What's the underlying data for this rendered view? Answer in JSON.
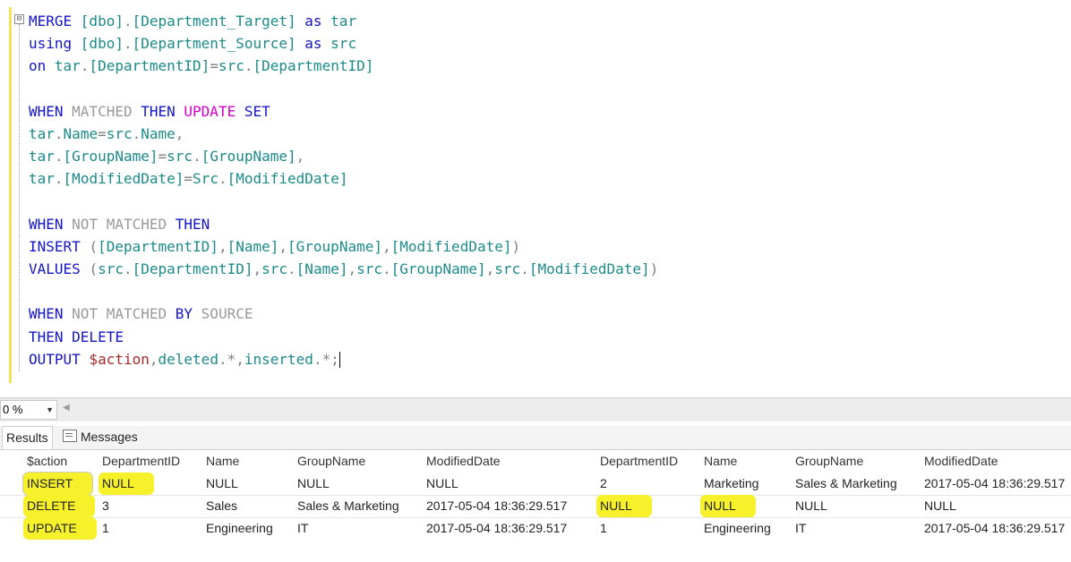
{
  "editor": {
    "collapse_glyph": "⊟",
    "lines": [
      [
        {
          "t": "MERGE ",
          "c": "kw"
        },
        {
          "t": "[dbo]",
          "c": "id"
        },
        {
          "t": ".",
          "c": "pu"
        },
        {
          "t": "[Department_Target]",
          "c": "id"
        },
        {
          "t": " as ",
          "c": "kw"
        },
        {
          "t": "tar",
          "c": "id"
        }
      ],
      [
        {
          "t": "using ",
          "c": "kw"
        },
        {
          "t": "[dbo]",
          "c": "id"
        },
        {
          "t": ".",
          "c": "pu"
        },
        {
          "t": "[Department_Source]",
          "c": "id"
        },
        {
          "t": " as ",
          "c": "kw"
        },
        {
          "t": "src",
          "c": "id"
        }
      ],
      [
        {
          "t": "on ",
          "c": "kw"
        },
        {
          "t": "tar",
          "c": "id"
        },
        {
          "t": ".",
          "c": "pu"
        },
        {
          "t": "[DepartmentID]",
          "c": "id"
        },
        {
          "t": "=",
          "c": "pu"
        },
        {
          "t": "src",
          "c": "id"
        },
        {
          "t": ".",
          "c": "pu"
        },
        {
          "t": "[DepartmentID]",
          "c": "id"
        }
      ],
      [],
      [
        {
          "t": "WHEN ",
          "c": "kw"
        },
        {
          "t": "MATCHED ",
          "c": "gr"
        },
        {
          "t": "THEN ",
          "c": "kw"
        },
        {
          "t": "UPDATE ",
          "c": "mg"
        },
        {
          "t": "SET",
          "c": "kw"
        }
      ],
      [
        {
          "t": "tar",
          "c": "id"
        },
        {
          "t": ".",
          "c": "pu"
        },
        {
          "t": "Name",
          "c": "id"
        },
        {
          "t": "=",
          "c": "pu"
        },
        {
          "t": "src",
          "c": "id"
        },
        {
          "t": ".",
          "c": "pu"
        },
        {
          "t": "Name",
          "c": "id"
        },
        {
          "t": ",",
          "c": "pu"
        }
      ],
      [
        {
          "t": "tar",
          "c": "id"
        },
        {
          "t": ".",
          "c": "pu"
        },
        {
          "t": "[GroupName]",
          "c": "id"
        },
        {
          "t": "=",
          "c": "pu"
        },
        {
          "t": "src",
          "c": "id"
        },
        {
          "t": ".",
          "c": "pu"
        },
        {
          "t": "[GroupName]",
          "c": "id"
        },
        {
          "t": ",",
          "c": "pu"
        }
      ],
      [
        {
          "t": "tar",
          "c": "id"
        },
        {
          "t": ".",
          "c": "pu"
        },
        {
          "t": "[ModifiedDate]",
          "c": "id"
        },
        {
          "t": "=",
          "c": "pu"
        },
        {
          "t": "Src",
          "c": "id"
        },
        {
          "t": ".",
          "c": "pu"
        },
        {
          "t": "[ModifiedDate]",
          "c": "id"
        }
      ],
      [],
      [
        {
          "t": "WHEN ",
          "c": "kw"
        },
        {
          "t": "NOT MATCHED ",
          "c": "gr"
        },
        {
          "t": "THEN",
          "c": "kw"
        }
      ],
      [
        {
          "t": "INSERT ",
          "c": "kw"
        },
        {
          "t": "(",
          "c": "pu"
        },
        {
          "t": "[DepartmentID]",
          "c": "id"
        },
        {
          "t": ",",
          "c": "pu"
        },
        {
          "t": "[Name]",
          "c": "id"
        },
        {
          "t": ",",
          "c": "pu"
        },
        {
          "t": "[GroupName]",
          "c": "id"
        },
        {
          "t": ",",
          "c": "pu"
        },
        {
          "t": "[ModifiedDate]",
          "c": "id"
        },
        {
          "t": ")",
          "c": "pu"
        }
      ],
      [
        {
          "t": "VALUES ",
          "c": "kw"
        },
        {
          "t": "(",
          "c": "pu"
        },
        {
          "t": "src",
          "c": "id"
        },
        {
          "t": ".",
          "c": "pu"
        },
        {
          "t": "[DepartmentID]",
          "c": "id"
        },
        {
          "t": ",",
          "c": "pu"
        },
        {
          "t": "src",
          "c": "id"
        },
        {
          "t": ".",
          "c": "pu"
        },
        {
          "t": "[Name]",
          "c": "id"
        },
        {
          "t": ",",
          "c": "pu"
        },
        {
          "t": "src",
          "c": "id"
        },
        {
          "t": ".",
          "c": "pu"
        },
        {
          "t": "[GroupName]",
          "c": "id"
        },
        {
          "t": ",",
          "c": "pu"
        },
        {
          "t": "src",
          "c": "id"
        },
        {
          "t": ".",
          "c": "pu"
        },
        {
          "t": "[ModifiedDate]",
          "c": "id"
        },
        {
          "t": ")",
          "c": "pu"
        }
      ],
      [],
      [
        {
          "t": "WHEN ",
          "c": "kw"
        },
        {
          "t": "NOT MATCHED ",
          "c": "gr"
        },
        {
          "t": "BY ",
          "c": "kw"
        },
        {
          "t": "SOURCE",
          "c": "gr"
        }
      ],
      [
        {
          "t": "THEN DELETE",
          "c": "kw"
        }
      ],
      [
        {
          "t": "OUTPUT ",
          "c": "kw"
        },
        {
          "t": "$action",
          "c": "sv"
        },
        {
          "t": ",",
          "c": "pu"
        },
        {
          "t": "deleted",
          "c": "id"
        },
        {
          "t": ".",
          "c": "pu"
        },
        {
          "t": "*",
          "c": "pu"
        },
        {
          "t": ",",
          "c": "pu"
        },
        {
          "t": "inserted",
          "c": "id"
        },
        {
          "t": ".",
          "c": "pu"
        },
        {
          "t": "*",
          "c": "pu"
        },
        {
          "t": ";",
          "c": "pu"
        },
        {
          "caret": true
        }
      ]
    ]
  },
  "zoom": {
    "value": "0 %",
    "dropdown_icon": "chevron-down-icon",
    "scroll_icon": "scroll-left-icon"
  },
  "tabs": {
    "results": "Results",
    "messages": "Messages",
    "messages_icon": "messages-icon"
  },
  "grid": {
    "columns": [
      "$action",
      "DepartmentID",
      "Name",
      "GroupName",
      "ModifiedDate",
      "DepartmentID",
      "Name",
      "GroupName",
      "ModifiedDate"
    ],
    "rows": [
      [
        "INSERT",
        "NULL",
        "NULL",
        "NULL",
        "NULL",
        "2",
        "Marketing",
        "Sales & Marketing",
        "2017-05-04 18:36:29.517"
      ],
      [
        "DELETE",
        "3",
        "Sales",
        "Sales & Marketing",
        "2017-05-04 18:36:29.517",
        "NULL",
        "NULL",
        "NULL",
        "NULL"
      ],
      [
        "UPDATE",
        "1",
        "Engineering",
        "IT",
        "2017-05-04 18:36:29.517",
        "1",
        "Engineering",
        "IT",
        "2017-05-04 18:36:29.517"
      ]
    ],
    "highlights": [
      [
        0,
        0
      ],
      [
        0,
        1
      ],
      [
        1,
        0
      ],
      [
        1,
        5
      ],
      [
        1,
        6
      ],
      [
        2,
        0
      ]
    ],
    "highlight_color": "#f6f12a"
  },
  "colors": {
    "keyword": "#1515c8",
    "inactive_keyword": "#9a9a9a",
    "update_keyword": "#d000c8",
    "identifier": "#1d8a8a",
    "system_variable": "#a52a2a",
    "change_bar": "#f2e15a"
  }
}
